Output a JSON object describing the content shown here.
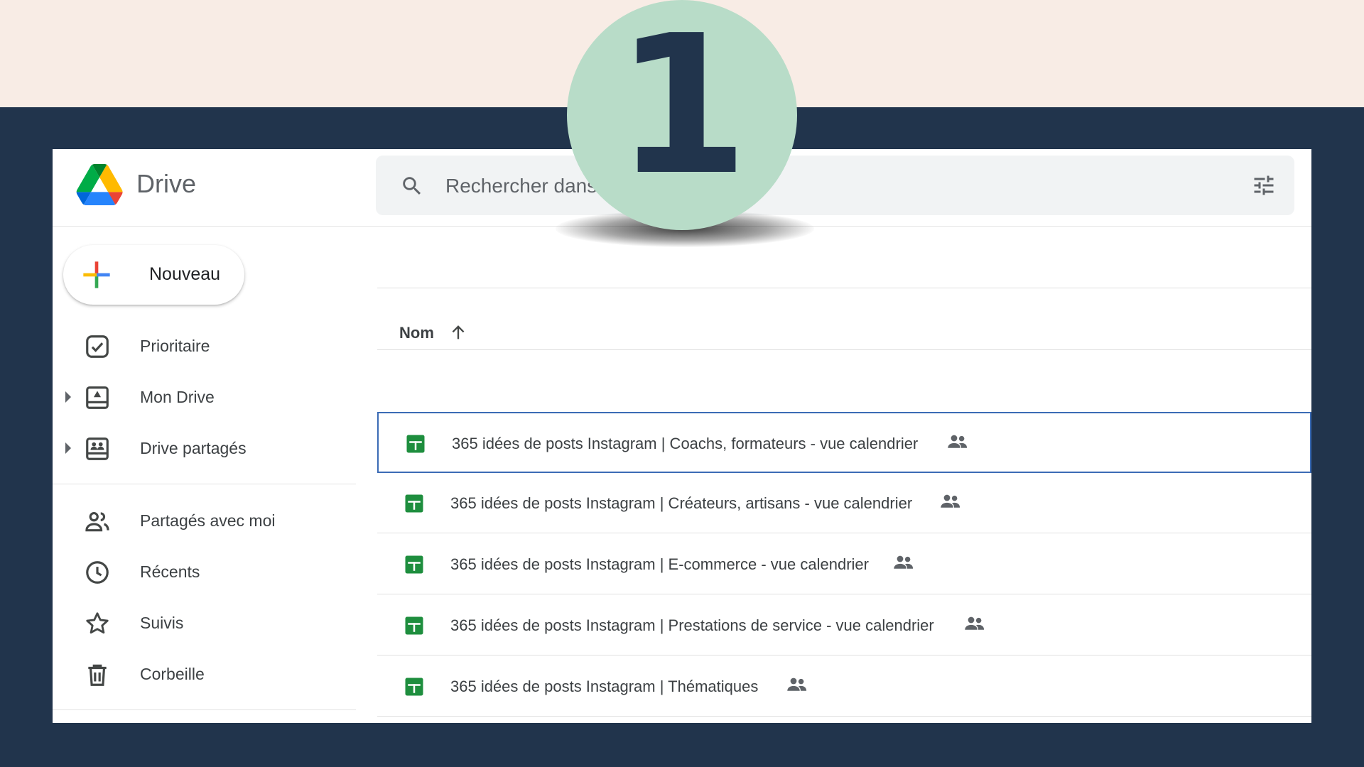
{
  "app": {
    "name": "Drive"
  },
  "search": {
    "placeholder": "Rechercher dans Drive"
  },
  "new_button": {
    "label": "Nouveau"
  },
  "sidebar": {
    "items": [
      {
        "label": "Prioritaire",
        "icon": "priority-icon"
      },
      {
        "label": "Mon Drive",
        "icon": "my-drive-icon"
      },
      {
        "label": "Drive partagés",
        "icon": "shared-drives-icon"
      },
      {
        "label": "Partagés avec moi",
        "icon": "people-icon"
      },
      {
        "label": "Récents",
        "icon": "clock-icon"
      },
      {
        "label": "Suivis",
        "icon": "star-icon"
      },
      {
        "label": "Corbeille",
        "icon": "trash-icon"
      }
    ]
  },
  "list": {
    "column_name": "Nom",
    "sort": "ascending",
    "files": [
      {
        "name": "365 idées de posts Instagram | Coachs, formateurs - vue calendrier",
        "shared": true,
        "selected": true
      },
      {
        "name": "365 idées de posts Instagram | Créateurs, artisans - vue calendrier",
        "shared": true,
        "selected": false
      },
      {
        "name": "365 idées de posts Instagram | E-commerce - vue calendrier",
        "shared": true,
        "selected": false
      },
      {
        "name": "365 idées de posts Instagram | Prestations de service - vue calendrier",
        "shared": true,
        "selected": false
      },
      {
        "name": "365 idées de posts Instagram | Thématiques",
        "shared": true,
        "selected": false
      }
    ]
  },
  "overlay": {
    "step_number": "1"
  },
  "colors": {
    "page_background": "#21344c",
    "top_band": "#f8ece5",
    "badge": "#b8dcc8",
    "selection_border": "#3b6bb5",
    "sheets_green": "#1e8e3e"
  }
}
